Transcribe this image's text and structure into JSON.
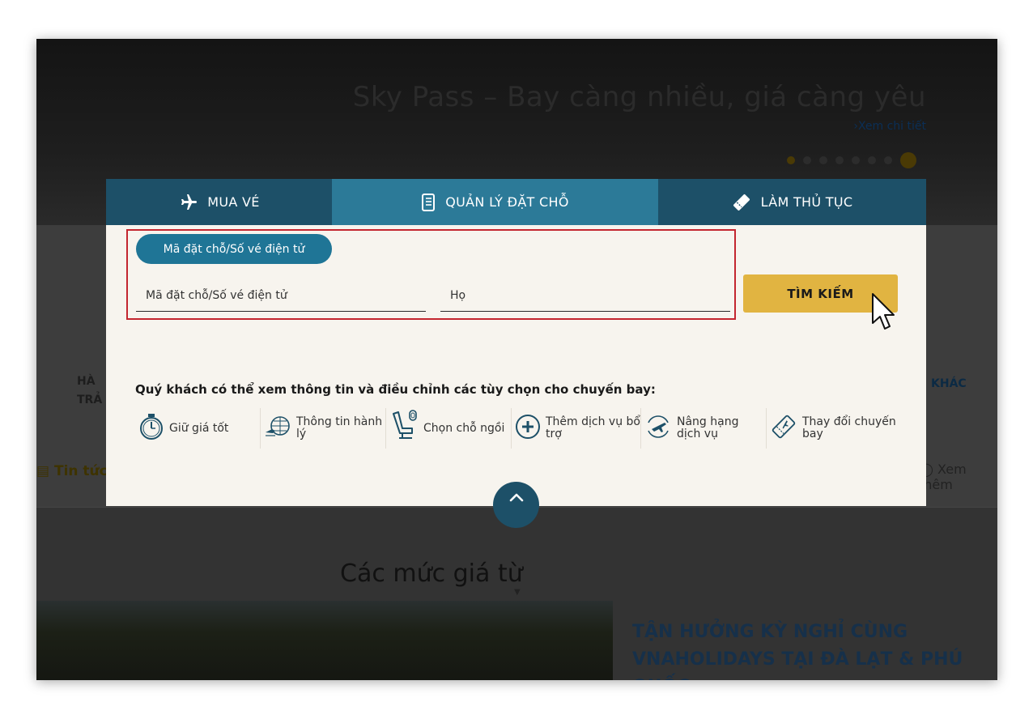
{
  "hero": {
    "title": "Sky Pass – Bay càng nhiều, giá càng yêu",
    "link": "›Xem chi tiết"
  },
  "background": {
    "left_label_1": "HÀ",
    "left_label_2": "TRẢ",
    "right_label": "KHÁC",
    "news": "Tin tức",
    "see_more": "Xem thêm",
    "prices_title": "Các mức giá từ",
    "promo_text": "TẬN HƯỞNG KỲ NGHỈ CÙNG VNAHOLIDAYS TẠI ĐÀ LẠT & PHÚ QUỐC"
  },
  "tabs": [
    {
      "label": "MUA VÉ",
      "icon": "airplane-icon"
    },
    {
      "label": "QUẢN LÝ ĐẶT CHỖ",
      "icon": "notebook-icon"
    },
    {
      "label": "LÀM THỦ TỤC",
      "icon": "ticket-icon"
    }
  ],
  "form": {
    "mode_pill": "Mã đặt chỗ/Số vé điện tử",
    "booking_placeholder": "Mã đặt chỗ/Số vé điện tử",
    "lastname_placeholder": "Họ",
    "search_button": "TÌM KIẾM"
  },
  "info": {
    "heading": "Quý khách có thể xem thông tin và điều chỉnh các tùy chọn cho chuyến bay:",
    "options": [
      {
        "label": "Giữ giá tốt",
        "icon": "stopwatch-icon"
      },
      {
        "label": "Thông tin hành lý",
        "icon": "baggage-icon"
      },
      {
        "label": "Chọn chỗ ngồi",
        "icon": "seat-icon"
      },
      {
        "label": "Thêm dịch vụ bổ trợ",
        "icon": "plus-circle-icon"
      },
      {
        "label": "Nâng hạng dịch vụ",
        "icon": "upgrade-icon"
      },
      {
        "label": "Thay đổi chuyến bay",
        "icon": "change-ticket-icon"
      }
    ]
  },
  "colors": {
    "tab_dark": "#1d5068",
    "tab_active": "#2c7a98",
    "search_button": "#e1b441",
    "highlight_border": "#c3262f"
  }
}
